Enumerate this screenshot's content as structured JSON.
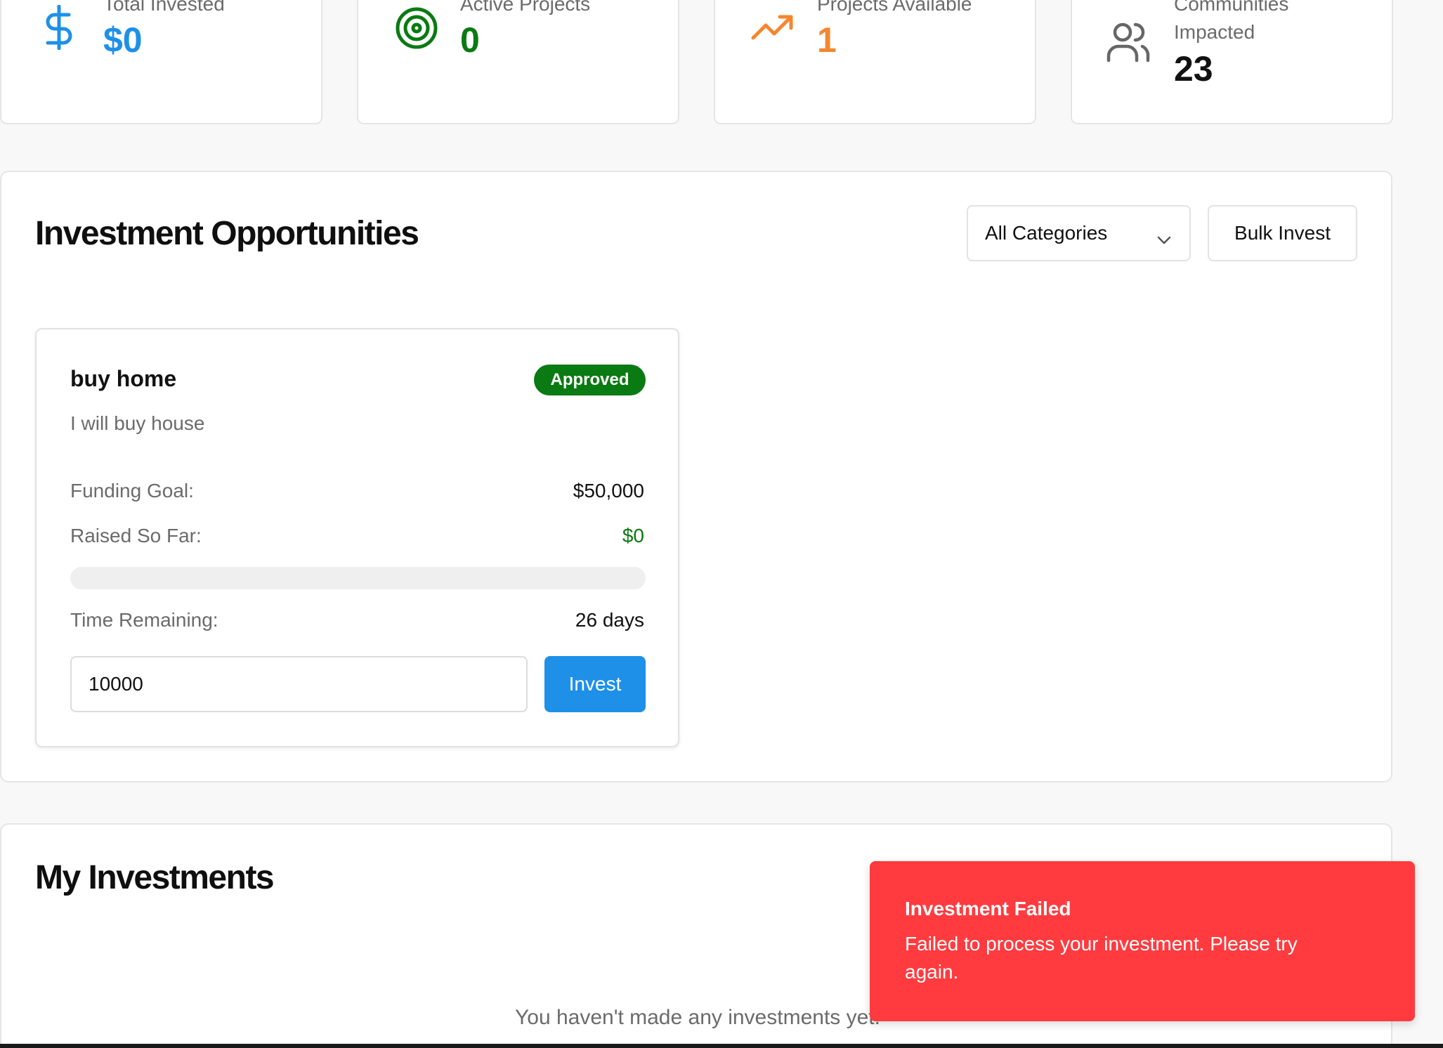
{
  "stats": [
    {
      "label": "Total Invested",
      "value": "$0",
      "icon": "dollar-icon",
      "color": "#1e90e8"
    },
    {
      "label": "Active Projects",
      "value": "0",
      "icon": "target-icon",
      "color": "#0a7a12"
    },
    {
      "label": "Projects Available",
      "value": "1",
      "icon": "trending-up-icon",
      "color": "#f5862e"
    },
    {
      "label": "Communities Impacted",
      "value": "23",
      "icon": "users-icon",
      "color": "#111111"
    }
  ],
  "opportunities": {
    "title": "Investment Opportunities",
    "category_select": {
      "selected": "All Categories"
    },
    "bulk_invest_label": "Bulk Invest",
    "projects": [
      {
        "title": "buy home",
        "status": "Approved",
        "description": "I will buy house",
        "funding_goal_label": "Funding Goal:",
        "funding_goal": "$50,000",
        "raised_label": "Raised So Far:",
        "raised": "$0",
        "progress_fraction": 0,
        "time_label": "Time Remaining:",
        "time_remaining": "26 days",
        "amount_value": "10000",
        "invest_label": "Invest"
      }
    ]
  },
  "my_investments": {
    "title": "My Investments",
    "empty_message": "You haven't made any investments yet."
  },
  "toast": {
    "title": "Investment Failed",
    "message": "Failed to process your investment. Please try again."
  },
  "colors": {
    "primary": "#1e90e8",
    "success": "#0a7a12",
    "warning": "#f5862e",
    "danger": "#ff3b3f"
  }
}
